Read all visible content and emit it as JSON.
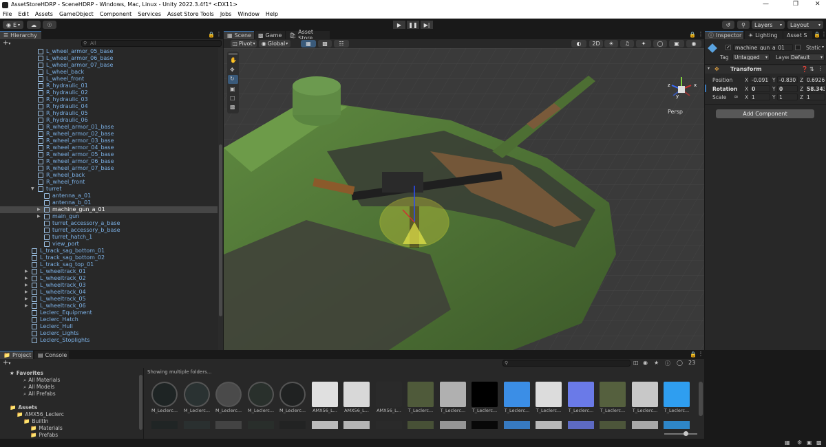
{
  "window": {
    "title": "AssetStoreHDRP - SceneHDRP - Windows, Mac, Linux - Unity 2022.3.4f1* <DX11>"
  },
  "menu": [
    "File",
    "Edit",
    "Assets",
    "GameObject",
    "Component",
    "Services",
    "Asset Store Tools",
    "Jobs",
    "Window",
    "Help"
  ],
  "toolbar": {
    "account_label": "E",
    "layers_label": "Layers",
    "layout_label": "Layout"
  },
  "hierarchy": {
    "tab": "Hierarchy",
    "search_placeholder": "All",
    "rows": [
      {
        "label": "L_wheel_armor_05_base",
        "indent": 55,
        "arrow": false
      },
      {
        "label": "L_wheel_armor_06_base",
        "indent": 55,
        "arrow": false
      },
      {
        "label": "L_wheel_armor_07_base",
        "indent": 55,
        "arrow": false
      },
      {
        "label": "L_wheel_back",
        "indent": 55,
        "arrow": false
      },
      {
        "label": "L_wheel_front",
        "indent": 55,
        "arrow": false
      },
      {
        "label": "R_hydraulic_01",
        "indent": 55,
        "arrow": false
      },
      {
        "label": "R_hydraulic_02",
        "indent": 55,
        "arrow": false
      },
      {
        "label": "R_hydraulic_03",
        "indent": 55,
        "arrow": false
      },
      {
        "label": "R_hydraulic_04",
        "indent": 55,
        "arrow": false
      },
      {
        "label": "R_hydraulic_05",
        "indent": 55,
        "arrow": false
      },
      {
        "label": "R_hydraulic_06",
        "indent": 55,
        "arrow": false
      },
      {
        "label": "R_wheel_armor_01_base",
        "indent": 55,
        "arrow": false
      },
      {
        "label": "R_wheel_armor_02_base",
        "indent": 55,
        "arrow": false
      },
      {
        "label": "R_wheel_armor_03_base",
        "indent": 55,
        "arrow": false
      },
      {
        "label": "R_wheel_armor_04_base",
        "indent": 55,
        "arrow": false
      },
      {
        "label": "R_wheel_armor_05_base",
        "indent": 55,
        "arrow": false
      },
      {
        "label": "R_wheel_armor_06_base",
        "indent": 55,
        "arrow": false
      },
      {
        "label": "R_wheel_armor_07_base",
        "indent": 55,
        "arrow": false
      },
      {
        "label": "R_wheel_back",
        "indent": 55,
        "arrow": false
      },
      {
        "label": "R_wheel_front",
        "indent": 55,
        "arrow": false
      },
      {
        "label": "turret",
        "indent": 55,
        "arrow": true,
        "open": true
      },
      {
        "label": "antenna_a_01",
        "indent": 64,
        "arrow": false
      },
      {
        "label": "antenna_b_01",
        "indent": 64,
        "arrow": false
      },
      {
        "label": "machine_gun_a_01",
        "indent": 64,
        "arrow": true,
        "selected": true
      },
      {
        "label": "main_gun",
        "indent": 64,
        "arrow": true
      },
      {
        "label": "turret_accessory_a_base",
        "indent": 64,
        "arrow": false
      },
      {
        "label": "turret_accessory_b_base",
        "indent": 64,
        "arrow": false
      },
      {
        "label": "turret_hatch_1",
        "indent": 64,
        "arrow": false
      },
      {
        "label": "view_port",
        "indent": 64,
        "arrow": false
      },
      {
        "label": "L_track_sag_bottom_01",
        "indent": 46,
        "arrow": false
      },
      {
        "label": "L_track_sag_bottom_02",
        "indent": 46,
        "arrow": false
      },
      {
        "label": "L_track_sag_top_01",
        "indent": 46,
        "arrow": false
      },
      {
        "label": "L_wheeltrack_01",
        "indent": 46,
        "arrow": true
      },
      {
        "label": "L_wheeltrack_02",
        "indent": 46,
        "arrow": true
      },
      {
        "label": "L_wheeltrack_03",
        "indent": 46,
        "arrow": true
      },
      {
        "label": "L_wheeltrack_04",
        "indent": 46,
        "arrow": true
      },
      {
        "label": "L_wheeltrack_05",
        "indent": 46,
        "arrow": true
      },
      {
        "label": "L_wheeltrack_06",
        "indent": 46,
        "arrow": true
      },
      {
        "label": "Leclerc_Equipment",
        "indent": 46,
        "arrow": false
      },
      {
        "label": "Leclerc_Hatch",
        "indent": 46,
        "arrow": false
      },
      {
        "label": "Leclerc_Hull",
        "indent": 46,
        "arrow": false
      },
      {
        "label": "Leclerc_Lights",
        "indent": 46,
        "arrow": false
      },
      {
        "label": "Leclerc_Stoplights",
        "indent": 46,
        "arrow": false
      }
    ]
  },
  "scene": {
    "tabs": [
      "Scene",
      "Game",
      "Asset Store"
    ],
    "pivot_label": "Pivot",
    "global_label": "Global",
    "mode_2d": "2D",
    "persp_label": "Persp",
    "gizmo_axes": [
      "y",
      "x",
      "z"
    ]
  },
  "inspector": {
    "tabs": [
      "Inspector",
      "Lighting",
      "Asset S"
    ],
    "object_name": "machine_gun_a_01",
    "static_label": "Static",
    "tag_label": "Tag",
    "tag_value": "Untagged",
    "layer_label": "Layer",
    "layer_value": "Default",
    "component_title": "Transform",
    "position_label": "Position",
    "rotation_label": "Rotation",
    "scale_label": "Scale",
    "axis_x": "X",
    "axis_y": "Y",
    "axis_z": "Z",
    "position": {
      "x": "-0.091",
      "y": "-0.830",
      "z": "0.6926"
    },
    "rotation": {
      "x": "0",
      "y": "0",
      "z": "58.343"
    },
    "scale": {
      "x": "1",
      "y": "1",
      "z": "1"
    },
    "add_component": "Add Component"
  },
  "project": {
    "tabs": [
      "Project",
      "Console"
    ],
    "showing_text": "Showing multiple folders...",
    "hidden_count": "23",
    "tree": [
      {
        "label": "Favorites",
        "x": 10,
        "bold": true
      },
      {
        "label": "All Materials",
        "x": 30
      },
      {
        "label": "All Models",
        "x": 30
      },
      {
        "label": "All Prefabs",
        "x": 30
      },
      {
        "label": "",
        "x": 0
      },
      {
        "label": "Assets",
        "x": 10,
        "bold": true
      },
      {
        "label": "AMX56_Leclerc",
        "x": 20
      },
      {
        "label": "BuiltIn",
        "x": 30
      },
      {
        "label": "Materials",
        "x": 40
      },
      {
        "label": "Prefabs",
        "x": 40
      }
    ],
    "assets": [
      {
        "label": "M_Leclerc...",
        "color": "#1e2424",
        "round": true
      },
      {
        "label": "M_Leclerc...",
        "color": "#2a3232",
        "round": true
      },
      {
        "label": "M_Leclerc...",
        "color": "#4a4a4a",
        "round": true
      },
      {
        "label": "M_Leclerc...",
        "color": "#29302c",
        "round": true
      },
      {
        "label": "M_Leclerc...",
        "color": "#202222",
        "round": true
      },
      {
        "label": "AMX56_L...",
        "color": "#e0e0e0",
        "round": false
      },
      {
        "label": "AMX56_L...",
        "color": "#d8d8d8",
        "round": false
      },
      {
        "label": "AMX56_L...",
        "color": "#2a2a2a",
        "round": false
      },
      {
        "label": "T_Leclerc...",
        "color": "#4f5a3a",
        "round": false
      },
      {
        "label": "T_Leclerc...",
        "color": "#b0b0b0",
        "round": false
      },
      {
        "label": "T_Leclerc...",
        "color": "#000000",
        "round": false
      },
      {
        "label": "T_Leclerc...",
        "color": "#3b8ee6",
        "round": false
      },
      {
        "label": "T_Leclerc...",
        "color": "#dcdcdc",
        "round": false
      },
      {
        "label": "T_Leclerc...",
        "color": "#6a7ae8",
        "round": false
      },
      {
        "label": "T_Leclerc...",
        "color": "#55603e",
        "round": false
      },
      {
        "label": "T_Leclerc...",
        "color": "#c8c8c8",
        "round": false
      },
      {
        "label": "T_Leclerc...",
        "color": "#2f9ef0",
        "round": false
      }
    ]
  },
  "colors": {
    "accent": "#3a79bb",
    "selection": "#464646",
    "object_blue": "#7cb1e6"
  }
}
